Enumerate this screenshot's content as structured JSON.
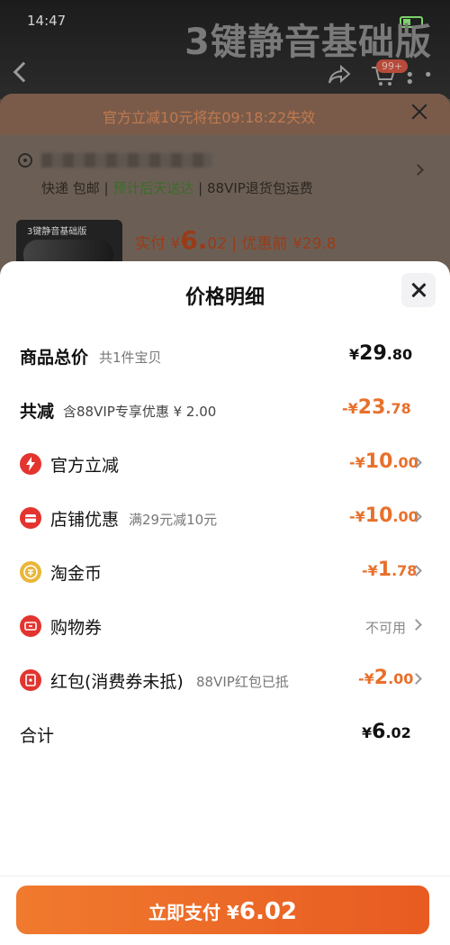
{
  "background": {
    "status_time": "14:47",
    "banner_title": "3键静音基础版",
    "cart_badge": "99+",
    "countdown": "官方立减10元将在09:18:22失效",
    "delivery_method": "快递 包邮",
    "delivery_eta": "预计后天送达",
    "return_note": "88VIP退货包运费",
    "product_thumb_text": "3键静音基础版",
    "paid_label": "实付 ¥",
    "paid_int": "6.",
    "paid_dec": "02",
    "before_discount": "| 优惠前 ¥29.8"
  },
  "sheet": {
    "title": "价格明细",
    "rows": [
      {
        "label": "商品总价",
        "sub": "共1件宝贝",
        "yen": "¥",
        "int": "29",
        "dec": ".80"
      },
      {
        "label": "共减",
        "sub": "含88VIP专享优惠 ¥ 2.00",
        "yen": "-¥",
        "int": "23",
        "dec": ".78"
      },
      {
        "label": "官方立减",
        "icon": "lightning-icon",
        "yen": "-¥",
        "int": "10",
        "dec": ".00"
      },
      {
        "label": "店铺优惠",
        "icon": "shop-icon",
        "sub": "满29元减10元",
        "yen": "-¥",
        "int": "10",
        "dec": ".00"
      },
      {
        "label": "淘金币",
        "icon": "coin-icon",
        "yen": "-¥",
        "int": "1",
        "dec": ".78"
      },
      {
        "label": "购物券",
        "icon": "ticket-icon",
        "status": "不可用"
      },
      {
        "label": "红包(消费券未抵)",
        "icon": "red-envelope-icon",
        "sub": "88VIP红包已抵",
        "yen": "-¥",
        "int": "2",
        "dec": ".00"
      },
      {
        "label": "合计",
        "yen": "¥",
        "int": "6",
        "dec": ".02"
      }
    ]
  },
  "pay_button": {
    "label": "立即支付 ¥",
    "amount": "6.02"
  },
  "colors": {
    "accent_orange": "#e8702c",
    "icon_red": "#e3342f",
    "icon_gold": "#e9b63a"
  }
}
